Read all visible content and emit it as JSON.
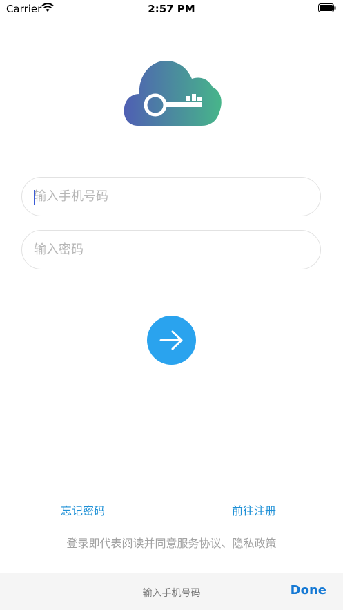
{
  "status_bar": {
    "carrier": "Carrier",
    "time": "2:57 PM"
  },
  "logo": {
    "icon": "cloud-key-icon",
    "gradient_start": "#4f5fb3",
    "gradient_end": "#47b58a"
  },
  "form": {
    "phone_placeholder": "输入手机号码",
    "phone_value": "",
    "password_placeholder": "输入密码",
    "password_value": "",
    "submit_icon": "arrow-right-icon",
    "submit_color": "#2aa3ee"
  },
  "links": {
    "forgot_password": "忘记密码",
    "register": "前往注册"
  },
  "agreement": "登录即代表阅读并同意服务协议、隐私政策",
  "keyboard_bar": {
    "title": "输入手机号码",
    "done": "Done"
  }
}
